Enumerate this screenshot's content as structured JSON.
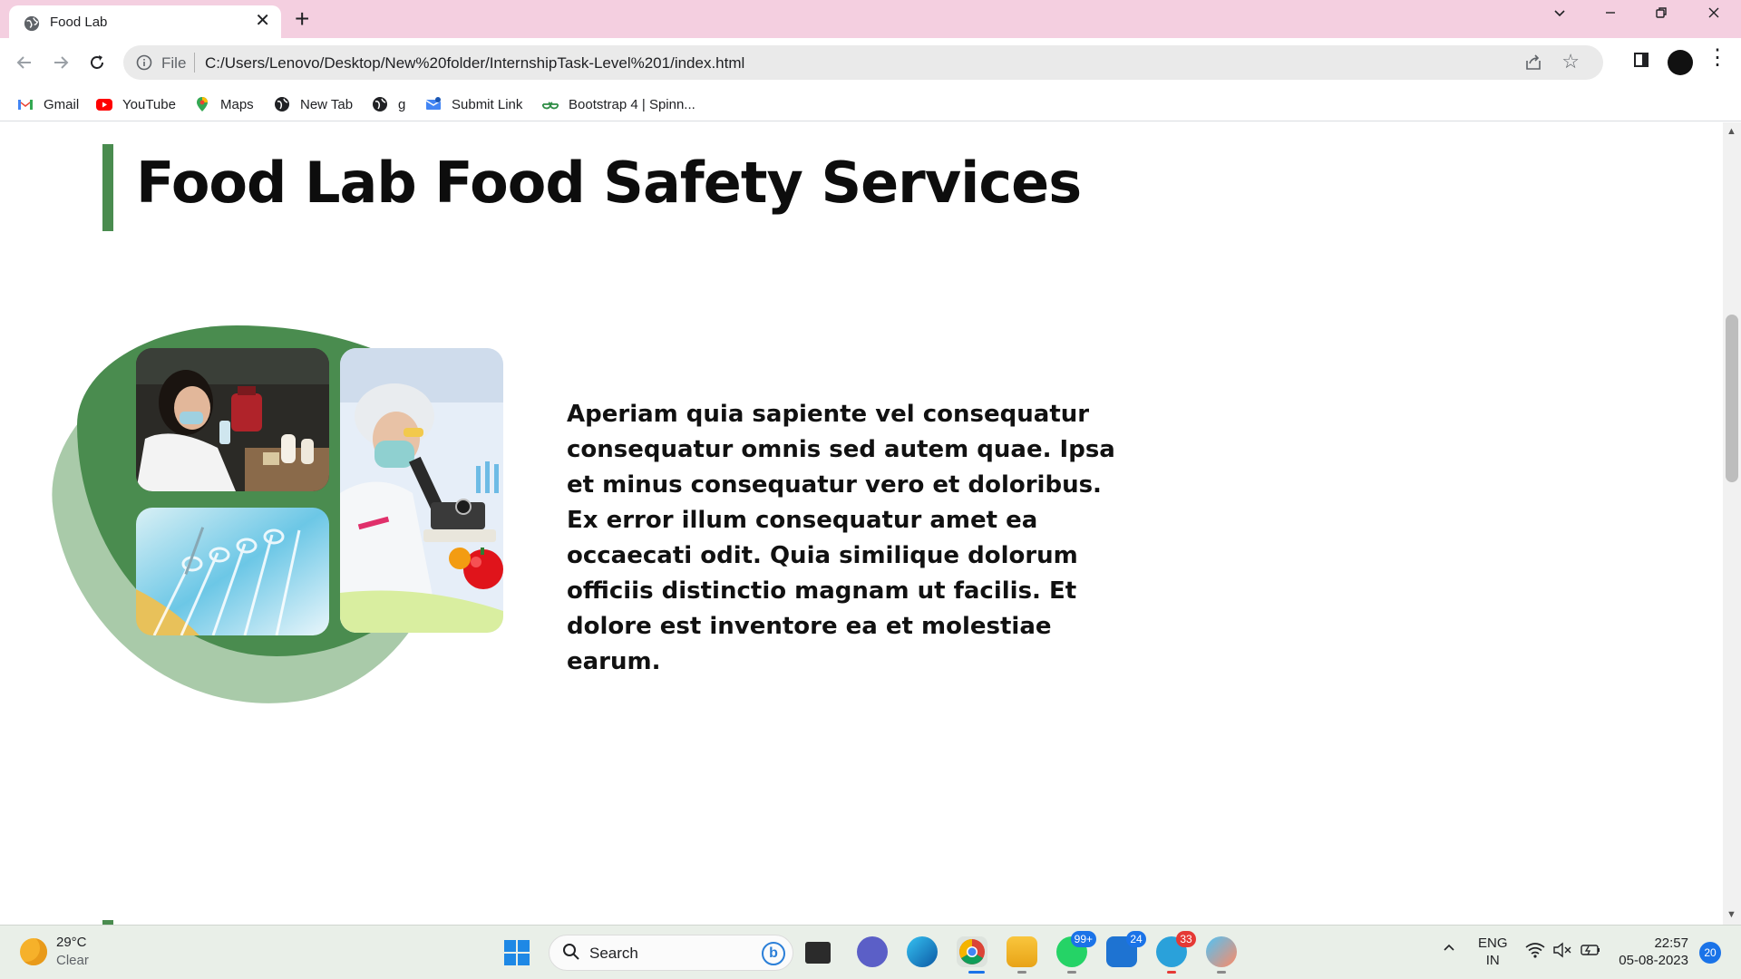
{
  "browser": {
    "tab_title": "Food Lab",
    "tab_close": "✕",
    "new_tab": "+",
    "scheme": "File",
    "url": "C:/Users/Lenovo/Desktop/New%20folder/InternshipTask-Level%201/index.html"
  },
  "bookmarks": [
    {
      "label": "Gmail",
      "icon": "gmail-icon",
      "color": "#ea4335"
    },
    {
      "label": "YouTube",
      "icon": "youtube-icon",
      "color": "#ff0000"
    },
    {
      "label": "Maps",
      "icon": "maps-icon",
      "color": "#34a853"
    },
    {
      "label": "New Tab",
      "icon": "globe-icon",
      "color": "#202124"
    },
    {
      "label": "g",
      "icon": "globe-icon",
      "color": "#202124"
    },
    {
      "label": "Submit Link",
      "icon": "submit-link-icon",
      "color": "#4285f4"
    },
    {
      "label": "Bootstrap 4 | Spinn...",
      "icon": "geeksforgeeks-icon",
      "color": "#2f8d46"
    }
  ],
  "page": {
    "heading": "Food Lab Food Safety Services",
    "paragraph": "Aperiam quia sapiente vel consequatur consequatur omnis sed autem quae. Ipsa et minus consequatur vero et doloribus. Ex error illum consequatur amet ea occaecati odit. Quia similique dolorum officiis distinctio magnam ut facilis. Et dolore est inventore ea et molestiae earum.",
    "accent_color": "#4a8c4f",
    "accent_light": "#a9caa9"
  },
  "taskbar": {
    "weather_temp": "29°C",
    "weather_desc": "Clear",
    "search_label": "Search",
    "whatsapp_badge": "99+",
    "mail_badge": "24",
    "telegram_badge": "33",
    "lang_top": "ENG",
    "lang_bottom": "IN",
    "time": "22:57",
    "date": "05-08-2023",
    "notifications": "20"
  }
}
